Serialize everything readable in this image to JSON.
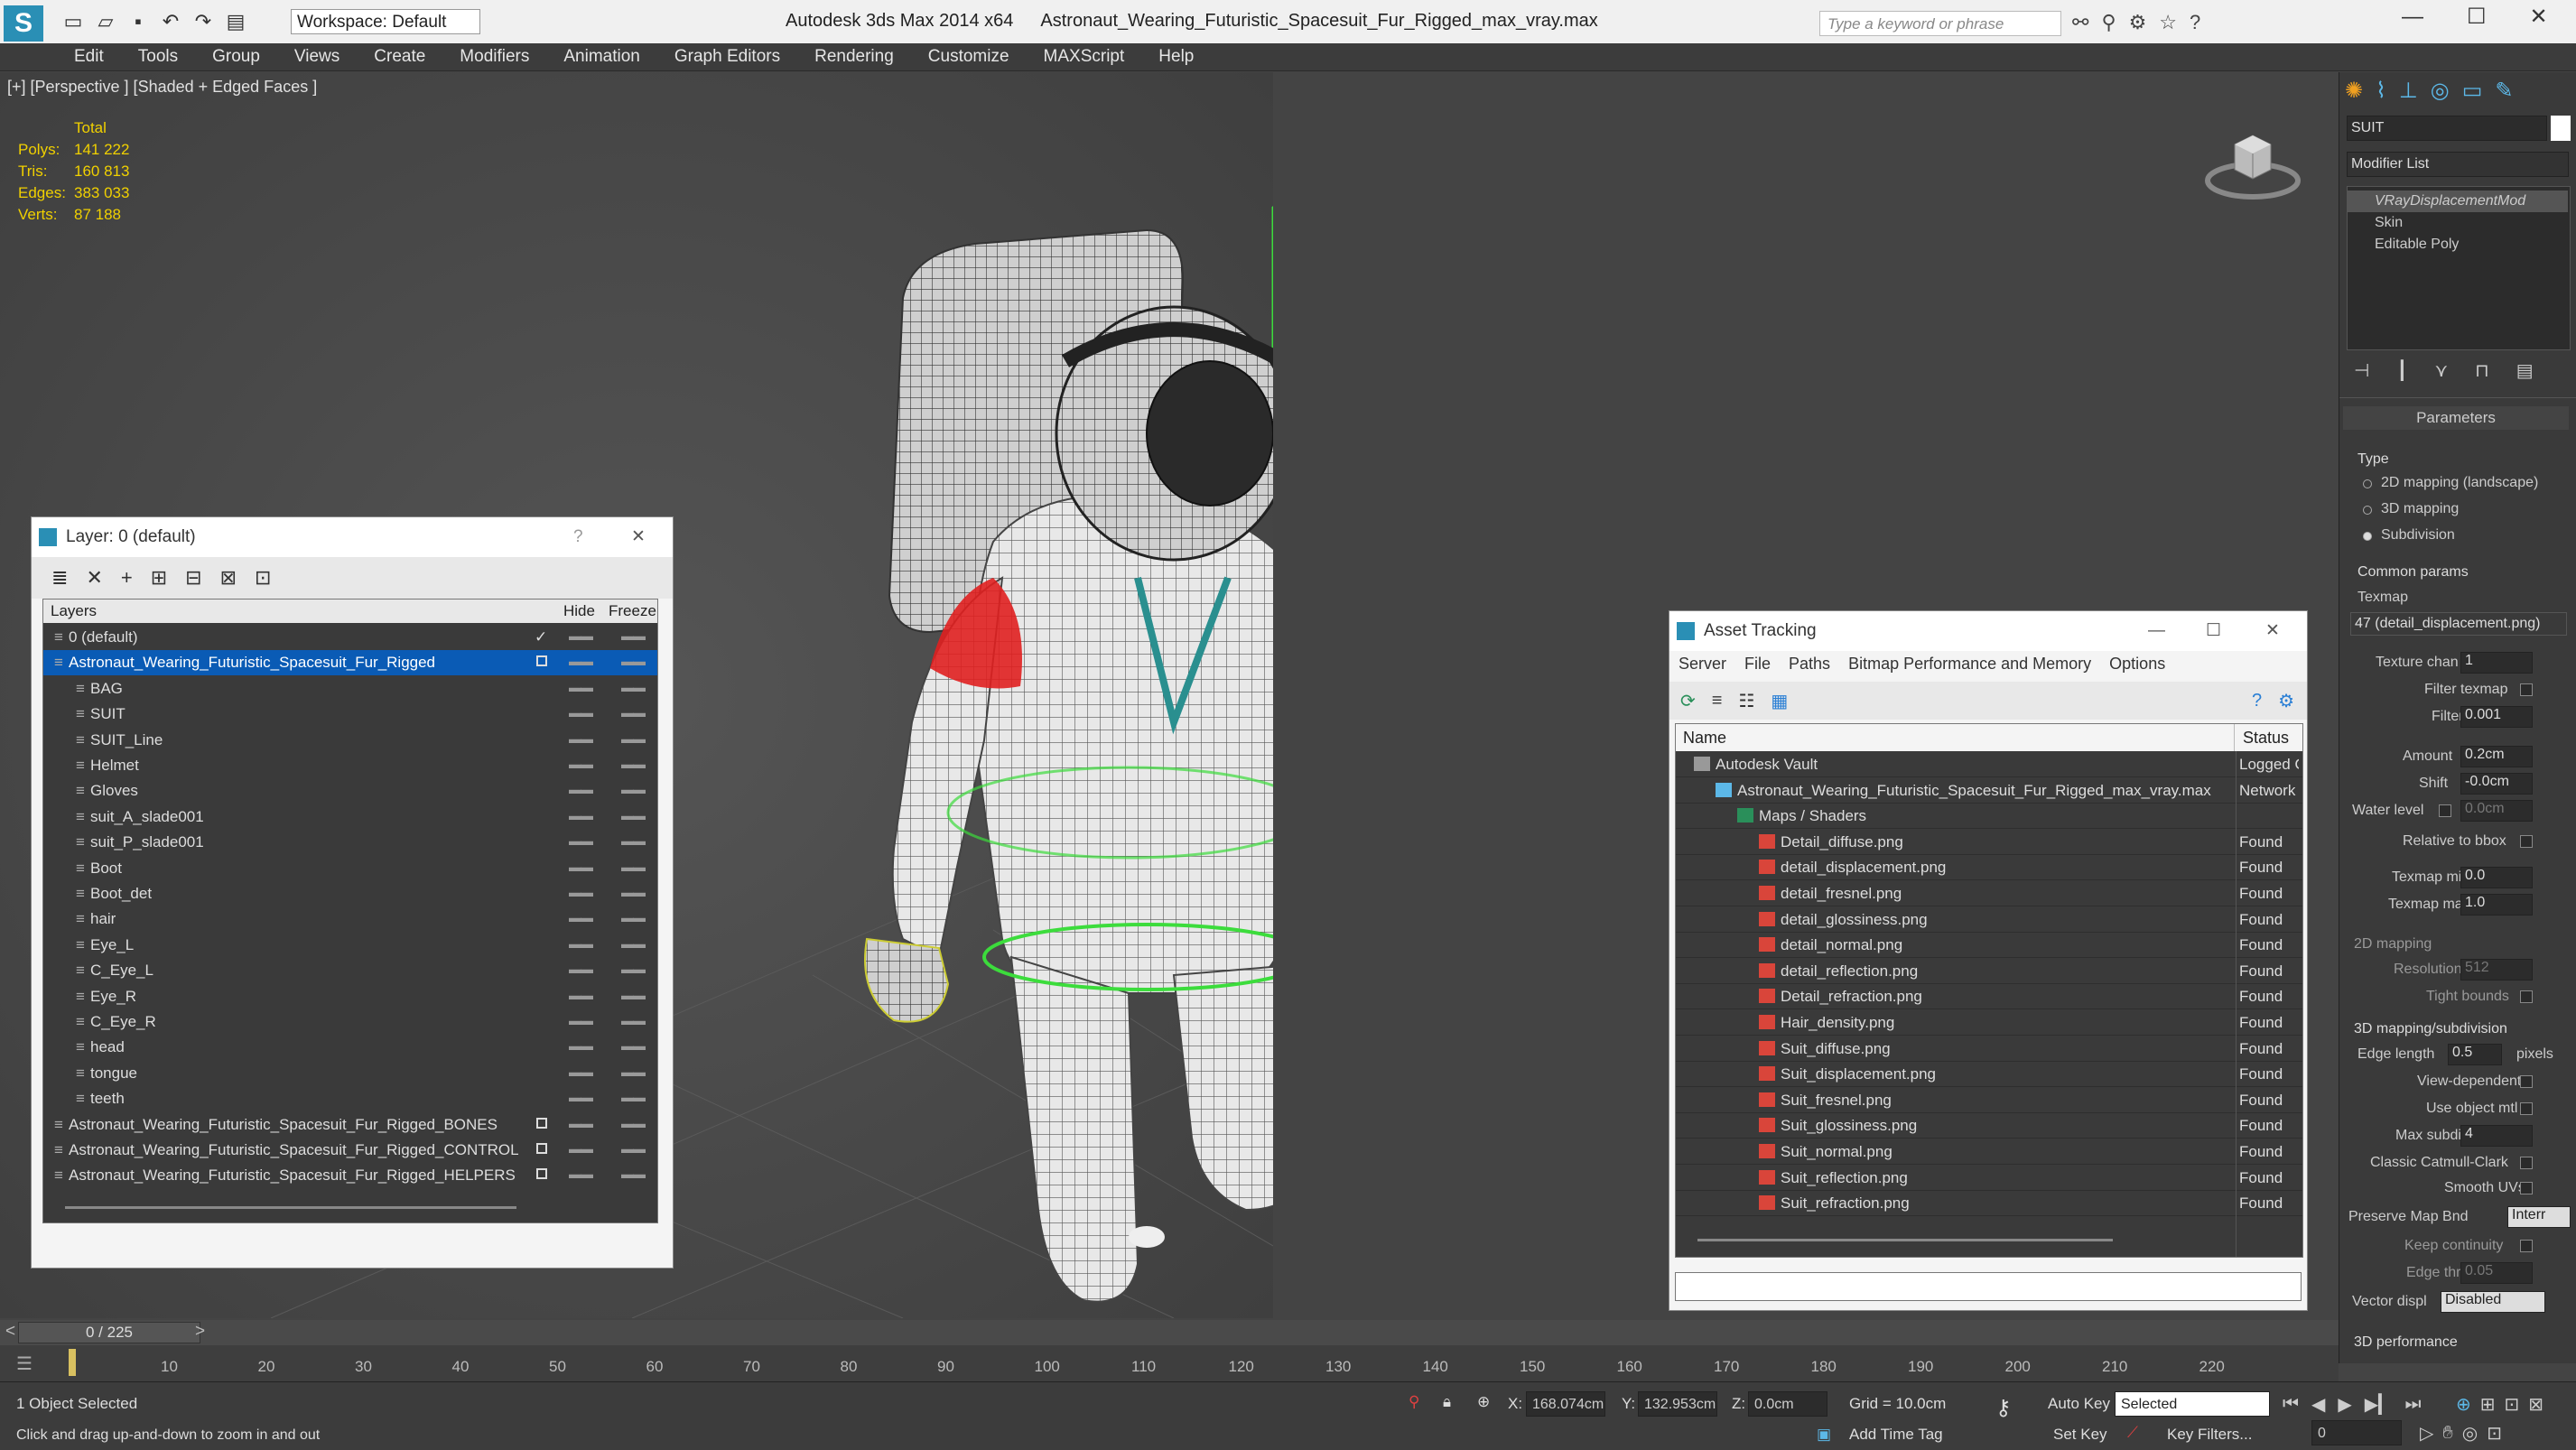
{
  "app": {
    "title": "Autodesk 3ds Max  2014 x64",
    "file": "Astronaut_Wearing_Futuristic_Spacesuit_Fur_Rigged_max_vray.max",
    "workspace": "Workspace: Default",
    "search_placeholder": "Type a keyword or phrase"
  },
  "menu": [
    "Edit",
    "Tools",
    "Group",
    "Views",
    "Create",
    "Modifiers",
    "Animation",
    "Graph Editors",
    "Rendering",
    "Customize",
    "MAXScript",
    "Help"
  ],
  "viewport": {
    "label": "[+] [Perspective ] [Shaded + Edged Faces ]",
    "stats": {
      "header": "Total",
      "rows": [
        {
          "k": "Polys:",
          "v": "141 222"
        },
        {
          "k": "Tris:",
          "v": "160 813"
        },
        {
          "k": "Edges:",
          "v": "383 033"
        },
        {
          "k": "Verts:",
          "v": "87 188"
        }
      ]
    }
  },
  "layer_panel": {
    "title": "Layer: 0 (default)",
    "help": "?",
    "close": "✕",
    "col_layers": "Layers",
    "col_hide": "Hide",
    "col_freeze": "Freeze",
    "rows": [
      {
        "name": "0 (default)",
        "indent": 0,
        "check": "✓"
      },
      {
        "name": "Astronaut_Wearing_Futuristic_Spacesuit_Fur_Rigged",
        "indent": 0
      },
      {
        "name": "BAG",
        "indent": 1
      },
      {
        "name": "SUIT",
        "indent": 1
      },
      {
        "name": "SUIT_Line",
        "indent": 1
      },
      {
        "name": "Helmet",
        "indent": 1
      },
      {
        "name": "Gloves",
        "indent": 1
      },
      {
        "name": "suit_A_slade001",
        "indent": 1
      },
      {
        "name": "suit_P_slade001",
        "indent": 1
      },
      {
        "name": "Boot",
        "indent": 1
      },
      {
        "name": "Boot_det",
        "indent": 1
      },
      {
        "name": "hair",
        "indent": 1
      },
      {
        "name": "Eye_L",
        "indent": 1
      },
      {
        "name": "C_Eye_L",
        "indent": 1
      },
      {
        "name": "Eye_R",
        "indent": 1
      },
      {
        "name": "C_Eye_R",
        "indent": 1
      },
      {
        "name": "head",
        "indent": 1
      },
      {
        "name": "tongue",
        "indent": 1
      },
      {
        "name": "teeth",
        "indent": 1
      },
      {
        "name": "Astronaut_Wearing_Futuristic_Spacesuit_Fur_Rigged_BONES",
        "indent": 0
      },
      {
        "name": "Astronaut_Wearing_Futuristic_Spacesuit_Fur_Rigged_CONTROL",
        "indent": 0
      },
      {
        "name": "Astronaut_Wearing_Futuristic_Spacesuit_Fur_Rigged_HELPERS",
        "indent": 0
      }
    ]
  },
  "asset_panel": {
    "title": "Asset Tracking",
    "menu": [
      "Server",
      "File",
      "Paths",
      "Bitmap Performance and Memory",
      "Options"
    ],
    "col_name": "Name",
    "col_status": "Status",
    "rows": [
      {
        "name": "Autodesk Vault",
        "status": "Logged Out",
        "indent": 0
      },
      {
        "name": "Astronaut_Wearing_Futuristic_Spacesuit_Fur_Rigged_max_vray.max",
        "status": "Network",
        "indent": 1
      },
      {
        "name": "Maps / Shaders",
        "status": "",
        "indent": 2
      },
      {
        "name": "Detail_diffuse.png",
        "status": "Found",
        "indent": 3
      },
      {
        "name": "detail_displacement.png",
        "status": "Found",
        "indent": 3
      },
      {
        "name": "detail_fresnel.png",
        "status": "Found",
        "indent": 3
      },
      {
        "name": "detail_glossiness.png",
        "status": "Found",
        "indent": 3
      },
      {
        "name": "detail_normal.png",
        "status": "Found",
        "indent": 3
      },
      {
        "name": "detail_reflection.png",
        "status": "Found",
        "indent": 3
      },
      {
        "name": "Detail_refraction.png",
        "status": "Found",
        "indent": 3
      },
      {
        "name": "Hair_density.png",
        "status": "Found",
        "indent": 3
      },
      {
        "name": "Suit_diffuse.png",
        "status": "Found",
        "indent": 3
      },
      {
        "name": "Suit_displacement.png",
        "status": "Found",
        "indent": 3
      },
      {
        "name": "Suit_fresnel.png",
        "status": "Found",
        "indent": 3
      },
      {
        "name": "Suit_glossiness.png",
        "status": "Found",
        "indent": 3
      },
      {
        "name": "Suit_normal.png",
        "status": "Found",
        "indent": 3
      },
      {
        "name": "Suit_reflection.png",
        "status": "Found",
        "indent": 3
      },
      {
        "name": "Suit_refraction.png",
        "status": "Found",
        "indent": 3
      }
    ]
  },
  "command_panel": {
    "object_name": "SUIT",
    "modifier_list": "Modifier List",
    "stack": [
      "VRayDisplacementMod",
      "Skin",
      "Editable Poly"
    ],
    "parameters": "Parameters",
    "type_label": "Type",
    "type_options": [
      "2D mapping (landscape)",
      "3D mapping",
      "Subdivision"
    ],
    "common_params": "Common params",
    "texmap_label": "Texmap",
    "texmap_value": "47 (detail_displacement.png)",
    "texture_chan_label": "Texture chan",
    "texture_chan": "1",
    "filter_texmap": "Filter texmap",
    "filter_blur_label": "Filter blur",
    "filter_blur": "0.001",
    "amount_label": "Amount",
    "amount": "0.2cm",
    "shift_label": "Shift",
    "shift": "-0.0cm",
    "water_level_label": "Water level",
    "water_level": "0.0cm",
    "relative_bbox": "Relative to bbox",
    "texmap_min_label": "Texmap min",
    "texmap_min": "0.0",
    "texmap_max_label": "Texmap max",
    "texmap_max": "1.0",
    "mapping_2d": "2D mapping",
    "resolution_label": "Resolution",
    "resolution": "512",
    "tight_bounds": "Tight bounds",
    "mapping_3d": "3D mapping/subdivision",
    "edge_length_label": "Edge length",
    "edge_length": "0.5",
    "pixels": "pixels",
    "view_dependent": "View-dependent",
    "use_object_mtl": "Use object mtl",
    "max_subdivs_label": "Max subdivs",
    "max_subdivs": "4",
    "classic_catmull": "Classic Catmull-Clark",
    "smooth_uvs": "Smooth UVs",
    "preserve_map_label": "Preserve Map Bnd",
    "preserve_map": "Interr",
    "keep_continuity": "Keep continuity",
    "edge_thresh_label": "Edge thresh",
    "edge_thresh": "0.05",
    "vector_displ_label": "Vector displ",
    "vector_displ": "Disabled",
    "perf_3d": "3D performance"
  },
  "timeline": {
    "frame": "0 / 225",
    "ticks": [
      "10",
      "20",
      "30",
      "40",
      "50",
      "60",
      "70",
      "80",
      "90",
      "100",
      "110",
      "120",
      "130",
      "140",
      "150",
      "160",
      "170",
      "180",
      "190",
      "200",
      "210",
      "220"
    ]
  },
  "status": {
    "selection": "1 Object Selected",
    "hint": "Click and drag up-and-down to zoom in and out",
    "x_label": "X:",
    "x": "168.074cm",
    "y_label": "Y:",
    "y": "132.953cm",
    "z_label": "Z:",
    "z": "0.0cm",
    "grid": "Grid = 10.0cm",
    "auto_key": "Auto Key",
    "set_key": "Set Key",
    "selected": "Selected",
    "key_filters": "Key Filters...",
    "add_time_tag": "Add Time Tag",
    "frame_field": "0"
  }
}
